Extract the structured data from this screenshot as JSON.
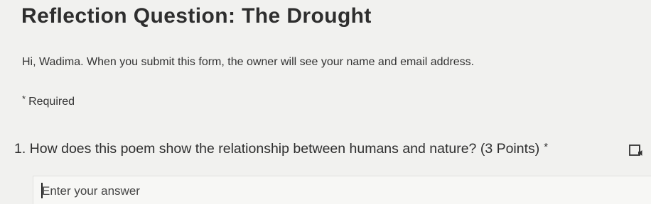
{
  "form": {
    "title": "Reflection Question: The Drought",
    "notice": "Hi, Wadima. When you submit this form, the owner will see your name and email address.",
    "required_label": "Required",
    "required_marker": "*"
  },
  "question": {
    "text": "1. How does this poem show the relationship between humans and nature? (3 Points)",
    "required_marker": "*",
    "reader_icon": "immersive-reader-icon"
  },
  "answer": {
    "placeholder": "Enter your answer",
    "value": ""
  }
}
